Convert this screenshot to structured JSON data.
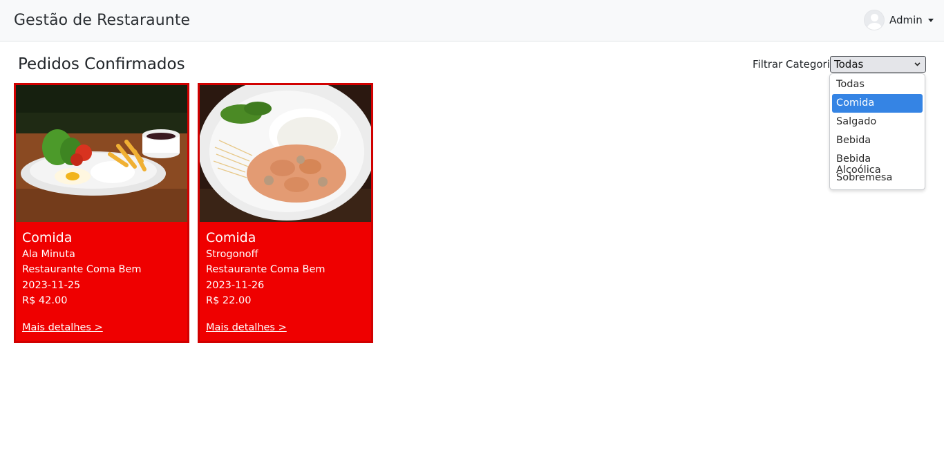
{
  "header": {
    "brand": "Gestão de Restaraunte",
    "user_name": "Admin"
  },
  "main": {
    "title": "Pedidos Confirmados",
    "filter": {
      "label": "Filtrar Categoria",
      "selected": "Todas",
      "options": [
        "Todas",
        "Comida",
        "Salgado",
        "Bebida",
        "Bebida Alcoólica",
        "Sobremesa"
      ],
      "highlighted": "Comida"
    },
    "orders": [
      {
        "category": "Comida",
        "name": "Ala Minuta",
        "restaurant": "Restaurante Coma Bem",
        "date": "2023-11-25",
        "price": "R$ 42.00",
        "link": "Mais detalhes >"
      },
      {
        "category": "Comida",
        "name": "Strogonoff",
        "restaurant": "Restaurante Coma Bem",
        "date": "2023-11-26",
        "price": "R$ 22.00",
        "link": "Mais detalhes >"
      }
    ]
  },
  "colors": {
    "card_bg": "#ef0000",
    "navbar_bg": "#f8f9fa",
    "option_highlight": "#3584e4"
  },
  "icons": [
    "avatar-icon",
    "caret-down-icon",
    "chevron-down-icon"
  ]
}
